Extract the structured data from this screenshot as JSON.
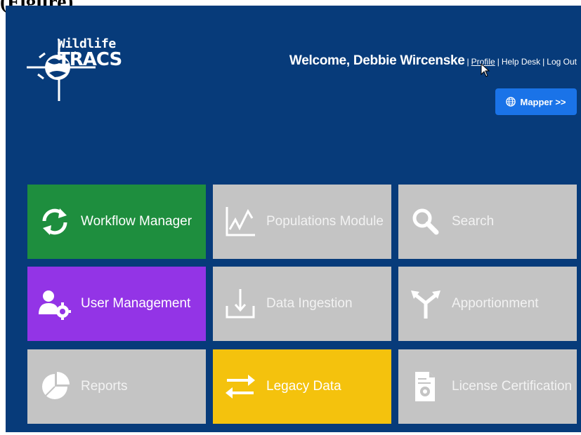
{
  "caption": "(Figure)",
  "app": {
    "logo": {
      "line1": "Wildlife",
      "line2": "TRACS"
    },
    "header": {
      "welcome": "Welcome, Debbie Wircenske",
      "links": [
        "Profile",
        "Help Desk",
        "Log Out"
      ],
      "separator": "|"
    },
    "mapper_button": {
      "label": "Mapper >>",
      "icon": "globe-icon"
    },
    "tiles": [
      {
        "label": "Workflow Manager",
        "icon": "refresh-icon",
        "color": "#1e8e3e"
      },
      {
        "label": "Populations Module",
        "icon": "line-chart-icon",
        "color": "#c4c4c4"
      },
      {
        "label": "Search",
        "icon": "search-icon",
        "color": "#c4c4c4"
      },
      {
        "label": "User Management",
        "icon": "users-gear-icon",
        "color": "#9334e6"
      },
      {
        "label": "Data Ingestion",
        "icon": "download-tray-icon",
        "color": "#c4c4c4"
      },
      {
        "label": "Apportionment",
        "icon": "split-arrows-icon",
        "color": "#c4c4c4"
      },
      {
        "label": "Reports",
        "icon": "pie-chart-icon",
        "color": "#c4c4c4"
      },
      {
        "label": "Legacy Data",
        "icon": "swap-arrows-icon",
        "color": "#f4c20d"
      },
      {
        "label": "License Certification",
        "icon": "document-gear-icon",
        "color": "#c4c4c4"
      }
    ],
    "background_color": "#073b7a",
    "mapper_color": "#1a73e8"
  }
}
